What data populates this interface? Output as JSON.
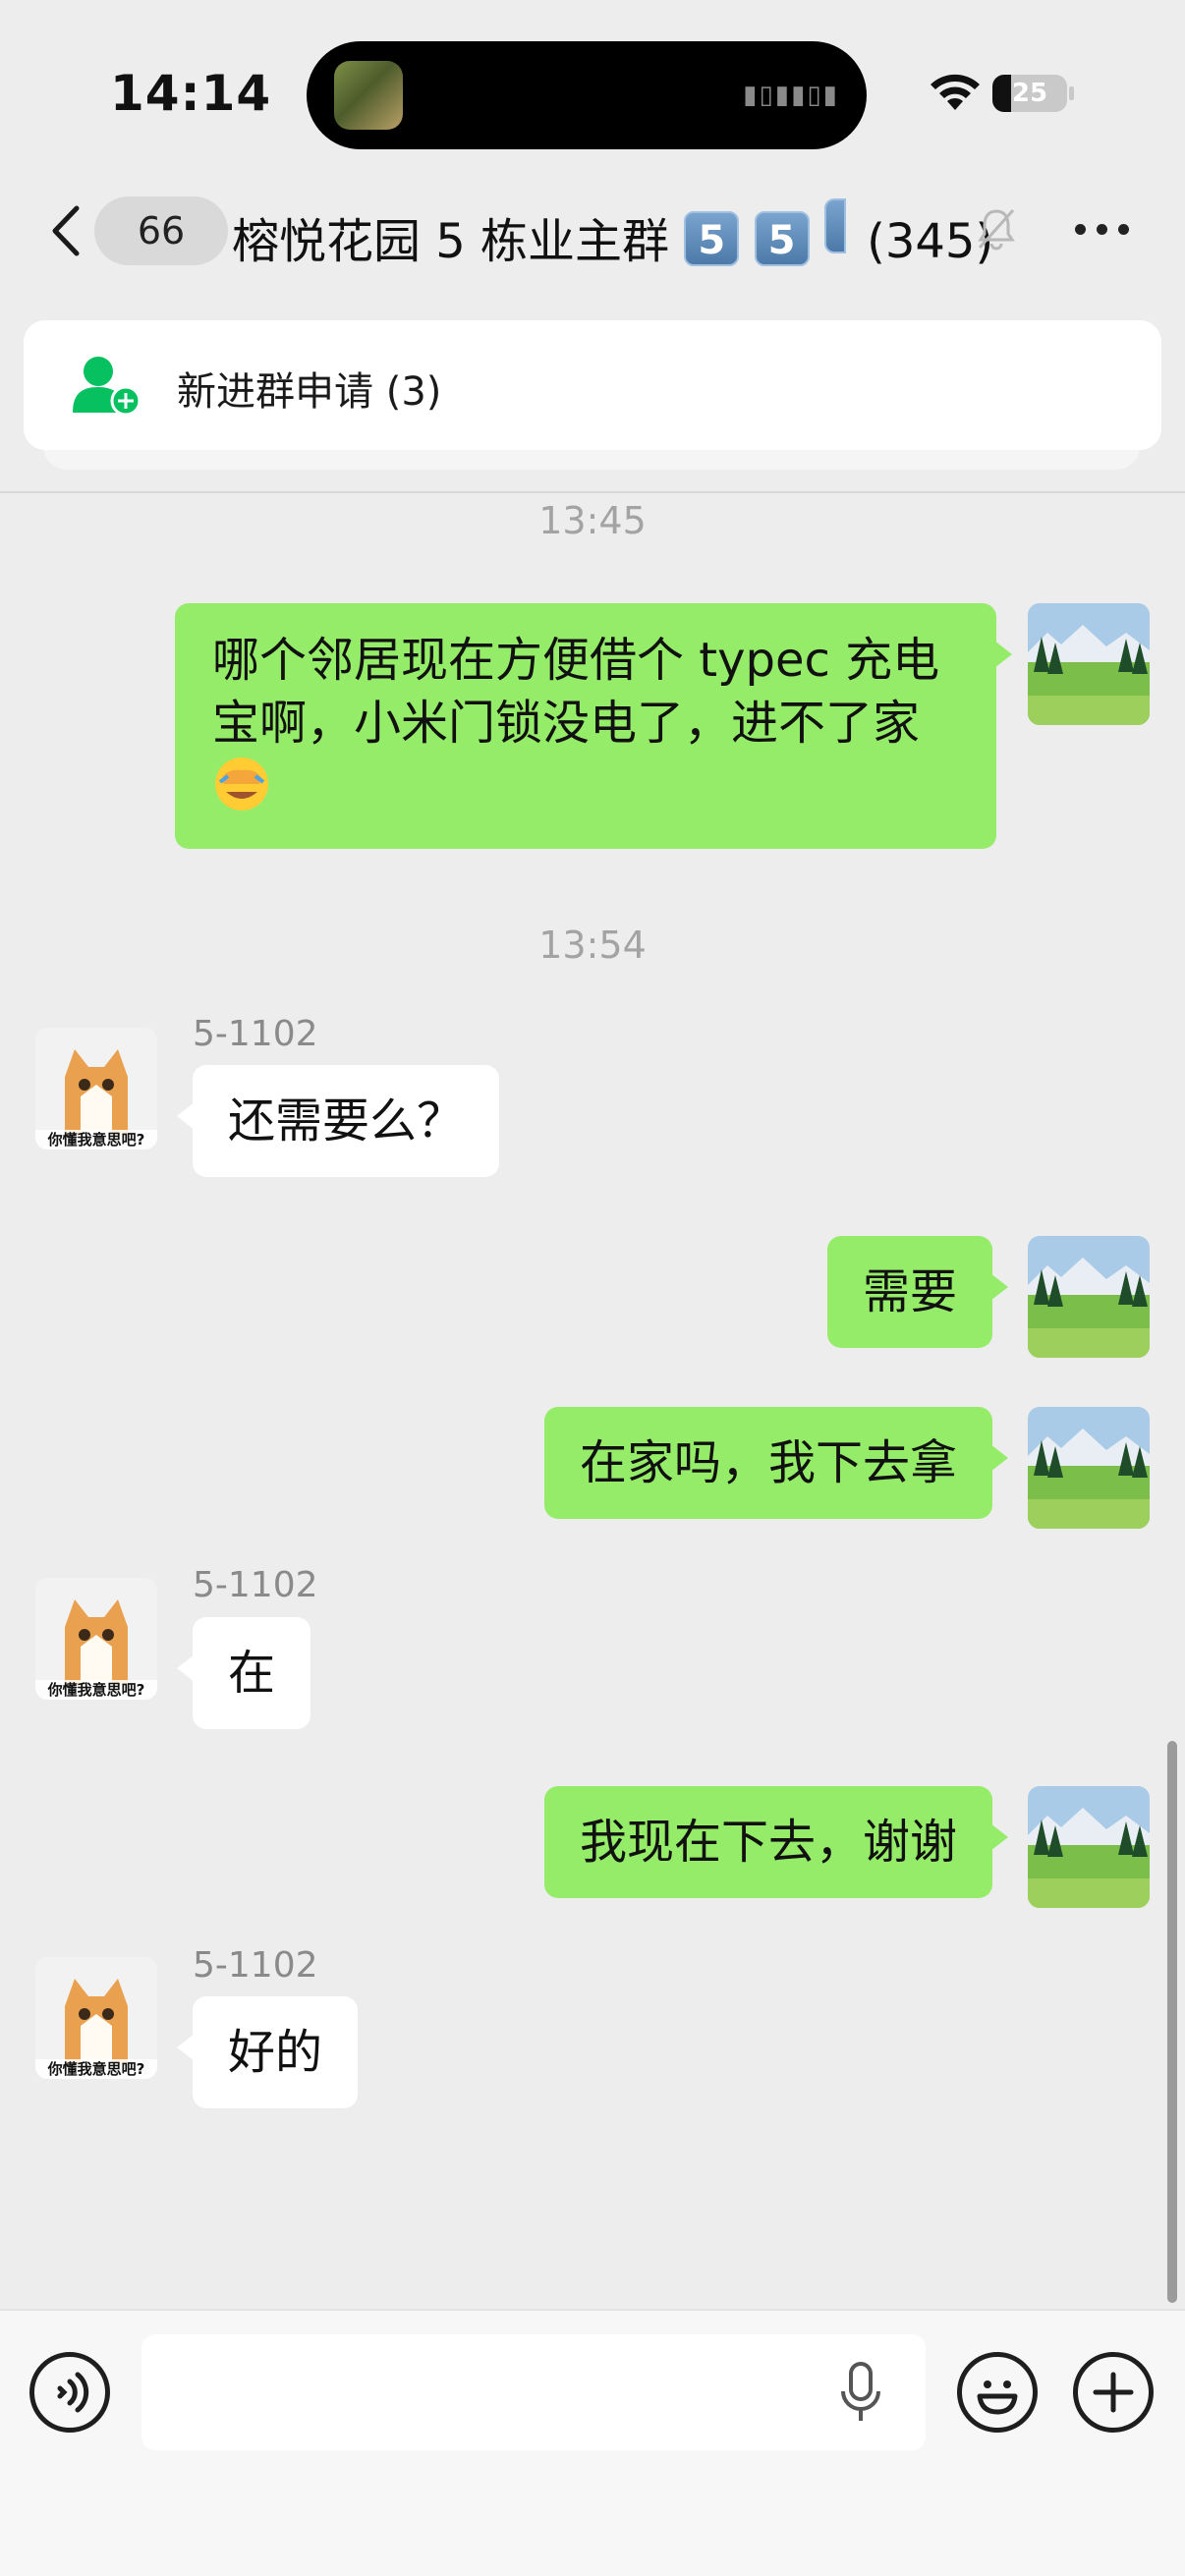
{
  "status_bar": {
    "time": "14:14",
    "battery_level": "25",
    "battery_percent": 25
  },
  "nav": {
    "back_count": "66",
    "title": "榕悦花园 5 栋业主群",
    "title_badges": [
      "5",
      "5"
    ],
    "member_count": "(345)",
    "muted": true
  },
  "banner": {
    "text": "新进群申请 (3)"
  },
  "colors": {
    "outgoing_bubble": "#95ec69",
    "incoming_bubble": "#ffffff",
    "background": "#ededed",
    "banner_icon": "#07c160"
  },
  "timestamps": [
    "13:45",
    "13:54"
  ],
  "messages": [
    {
      "direction": "out",
      "text": "哪个邻居现在方便借个 typec 充电宝啊，小米门锁没电了，进不了家",
      "emoji": "face-with-hand-over-eyes"
    },
    {
      "direction": "in",
      "sender": "5-1102",
      "text": "还需要么？",
      "avatar_caption": "你懂我意思吧?"
    },
    {
      "direction": "out",
      "text": "需要"
    },
    {
      "direction": "out",
      "text": "在家吗，我下去拿"
    },
    {
      "direction": "in",
      "sender": "5-1102",
      "text": "在",
      "avatar_caption": "你懂我意思吧?"
    },
    {
      "direction": "out",
      "text": "我现在下去，谢谢"
    },
    {
      "direction": "in",
      "sender": "5-1102",
      "text": "好的",
      "avatar_caption": "你懂我意思吧?"
    }
  ],
  "input": {
    "value": "",
    "placeholder": ""
  },
  "icons": {
    "voice_toggle": "voice-icon",
    "mic": "microphone-icon",
    "emoji": "emoji-icon",
    "plus": "plus-icon",
    "mute": "bell-slash-icon",
    "more": "more-icon",
    "back": "chevron-left-icon",
    "banner": "add-user-icon"
  }
}
